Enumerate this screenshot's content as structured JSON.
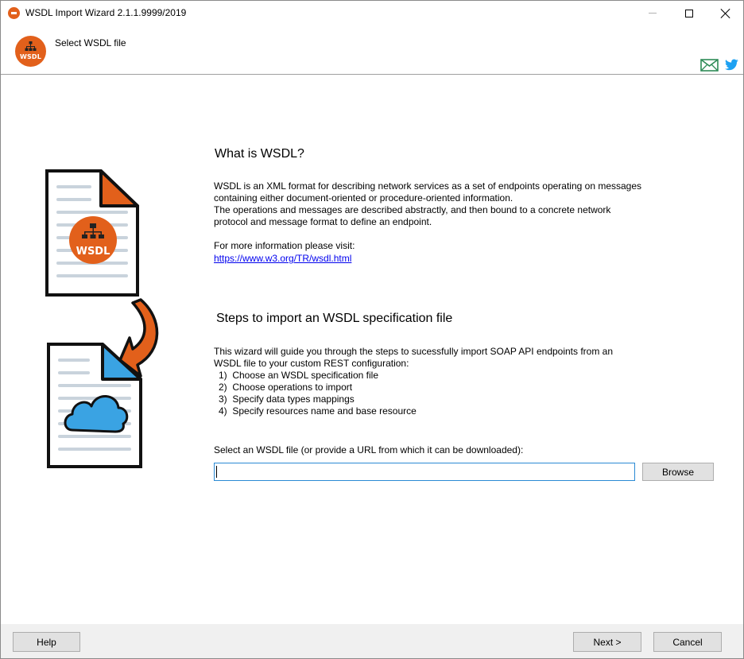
{
  "window": {
    "title": "WSDL Import Wizard 2.1.1.9999/2019"
  },
  "header": {
    "logo_text": "WSDL",
    "title": "Select WSDL file",
    "icons": [
      "mail-icon",
      "twitter-icon"
    ]
  },
  "illustration": {
    "badge_text": "WSDL",
    "icons": [
      "wsdl-document-icon",
      "arrow-icon",
      "cloud-document-icon"
    ]
  },
  "section_what": {
    "heading": "What is WSDL?",
    "lines": [
      "WSDL is an XML format for describing network services as a set of endpoints operating on messages",
      "containing either document-oriented or procedure-oriented information.",
      "The operations and messages are described abstractly, and then bound to a concrete network",
      "protocol and message format to define an endpoint."
    ],
    "more_info": "For more information please visit:",
    "link": "https://www.w3.org/TR/wsdl.html"
  },
  "section_steps": {
    "heading": "Steps to import an WSDL specification file",
    "intro_lines": [
      "This wizard will guide you through the steps to sucessfully import SOAP API endpoints from an",
      "WSDL file to your custom REST configuration:"
    ],
    "steps": [
      {
        "num": "1)",
        "text": "Choose an WSDL specification file"
      },
      {
        "num": "2)",
        "text": "Choose operations to import"
      },
      {
        "num": "3)",
        "text": "Specify data types mappings"
      },
      {
        "num": "4)",
        "text": "Specify resources name and base resource"
      }
    ]
  },
  "file_select": {
    "label": "Select an WSDL file (or provide a URL from which it can be downloaded):",
    "value": "",
    "browse_label": "Browse"
  },
  "footer": {
    "help_label": "Help",
    "next_label": "Next >",
    "cancel_label": "Cancel"
  },
  "colors": {
    "accent_orange": "#e2601b",
    "cloud_blue": "#3aa3e3",
    "link_blue": "#0000ee",
    "mail_green": "#2e8b57",
    "twitter_blue": "#1da1f2"
  }
}
